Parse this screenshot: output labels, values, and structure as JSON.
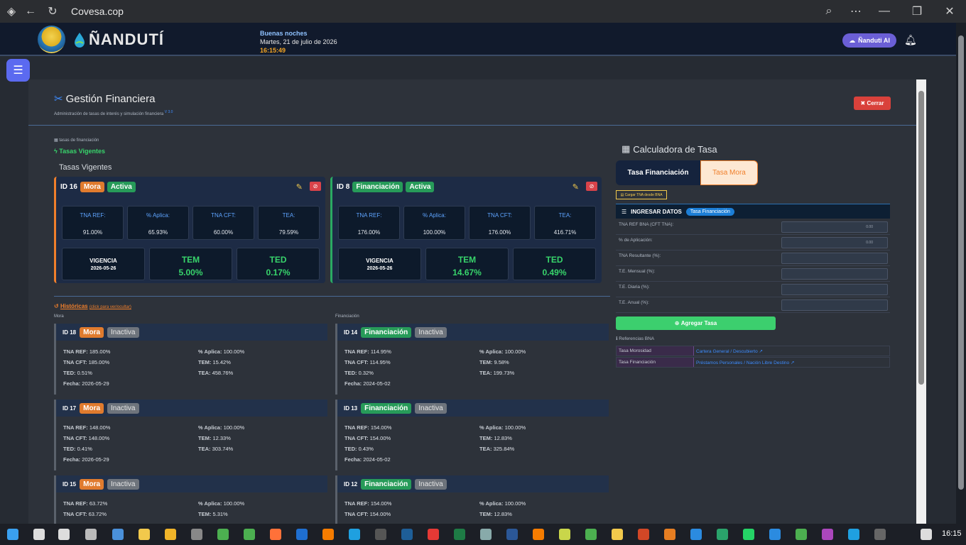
{
  "browser": {
    "url": "Covesa.cop"
  },
  "header": {
    "brand": "ÑANDUTÍ",
    "greeting": "Buenas noches",
    "date": "Martes, 21 de julio de 2026",
    "time": "16:15:49",
    "ai_label": "Ñanduti AI"
  },
  "page": {
    "title": "Gestión Financiera",
    "subtitle": "Administración de tasas de interés y simulación financiera",
    "version": "V 3.0",
    "close_label": "Cerrar",
    "breadcrumb": "tasas de financiación",
    "section_label": "Tasas Vigentes",
    "section_heading": "Tasas Vigentes"
  },
  "active": [
    {
      "id": "ID 16",
      "type": "Mora",
      "status": "Activa",
      "tna_ref_label": "TNA REF:",
      "tna_ref": "91.00%",
      "aplica_label": "% Aplica:",
      "aplica": "65.93%",
      "tna_cft_label": "TNA CFT:",
      "tna_cft": "60.00%",
      "tea_label": "TEA:",
      "tea": "79.59%",
      "vigencia_label": "VIGENCIA",
      "vigencia": "2026-05-26",
      "tem_label": "TEM",
      "tem": "5.00%",
      "ted_label": "TED",
      "ted": "0.17%"
    },
    {
      "id": "ID 8",
      "type": "Financiación",
      "status": "Activa",
      "tna_ref_label": "TNA REF:",
      "tna_ref": "176.00%",
      "aplica_label": "% Aplica:",
      "aplica": "100.00%",
      "tna_cft_label": "TNA CFT:",
      "tna_cft": "176.00%",
      "tea_label": "TEA:",
      "tea": "416.71%",
      "vigencia_label": "VIGENCIA",
      "vigencia": "2026-05-26",
      "tem_label": "TEM",
      "tem": "14.67%",
      "ted_label": "TED",
      "ted": "0.49%"
    }
  ],
  "historicas": {
    "title": "Históricas",
    "hint": "(click para ver/ocultar)",
    "mora_label": "Mora",
    "fin_label": "Financiación",
    "labels": {
      "tna_ref": "TNA REF:",
      "tna_cft": "TNA CFT:",
      "ted": "TED:",
      "fecha": "Fecha:",
      "aplica": "% Aplica:",
      "tem": "TEM:",
      "tea": "TEA:"
    },
    "mora": [
      {
        "id": "ID 18",
        "type": "Mora",
        "status": "Inactiva",
        "tna_ref": "185.00%",
        "tna_cft": "185.00%",
        "ted": "0.51%",
        "fecha": "2026-05-29",
        "aplica": "100.00%",
        "tem": "15.42%",
        "tea": "458.76%"
      },
      {
        "id": "ID 17",
        "type": "Mora",
        "status": "Inactiva",
        "tna_ref": "148.00%",
        "tna_cft": "148.00%",
        "ted": "0.41%",
        "fecha": "2026-05-29",
        "aplica": "100.00%",
        "tem": "12.33%",
        "tea": "303.74%"
      },
      {
        "id": "ID 15",
        "type": "Mora",
        "status": "Inactiva",
        "tna_ref": "63.72%",
        "tna_cft": "63.72%",
        "ted": "",
        "fecha": "",
        "aplica": "100.00%",
        "tem": "5.31%",
        "tea": ""
      }
    ],
    "fin": [
      {
        "id": "ID 14",
        "type": "Financiación",
        "status": "Inactiva",
        "tna_ref": "114.95%",
        "tna_cft": "114.95%",
        "ted": "0.32%",
        "fecha": "2024-05-02",
        "aplica": "100.00%",
        "tem": "9.58%",
        "tea": "199.73%"
      },
      {
        "id": "ID 13",
        "type": "Financiación",
        "status": "Inactiva",
        "tna_ref": "154.00%",
        "tna_cft": "154.00%",
        "ted": "0.43%",
        "fecha": "2024-05-02",
        "aplica": "100.00%",
        "tem": "12.83%",
        "tea": "325.84%"
      },
      {
        "id": "ID 12",
        "type": "Financiación",
        "status": "Inactiva",
        "tna_ref": "154.00%",
        "tna_cft": "154.00%",
        "ted": "",
        "fecha": "",
        "aplica": "100.00%",
        "tem": "12.83%",
        "tea": ""
      }
    ]
  },
  "calc": {
    "title": "Calculadora de Tasa",
    "tab_fin": "Tasa Financiación",
    "tab_mora": "Tasa Mora",
    "load_bna": "Cargar TNA desde BNA",
    "ingresar": "INGRESAR DATOS",
    "pill": "Tasa Financiación",
    "fields": [
      {
        "label": "TNA REF BNA (CFT TNA):",
        "placeholder": "0.00"
      },
      {
        "label": "% de Aplicación:",
        "placeholder": "0.00"
      },
      {
        "label": "TNA Resultante (%):",
        "placeholder": ""
      },
      {
        "label": "T.E. Mensual (%):",
        "placeholder": ""
      },
      {
        "label": "T.E. Diaria (%):",
        "placeholder": ""
      },
      {
        "label": "T.E. Anual (%):",
        "placeholder": ""
      }
    ],
    "add_label": "Agregar Tasa",
    "ref_title": "Referencias BNA",
    "refs": [
      {
        "k": "Tasa Morosidad",
        "v": "Cartera General / Descubierto"
      },
      {
        "k": "Tasa Financiación",
        "v": "Préstamos Personales / Nación Libre Destino"
      }
    ]
  },
  "taskbar": {
    "time": "16:15"
  }
}
